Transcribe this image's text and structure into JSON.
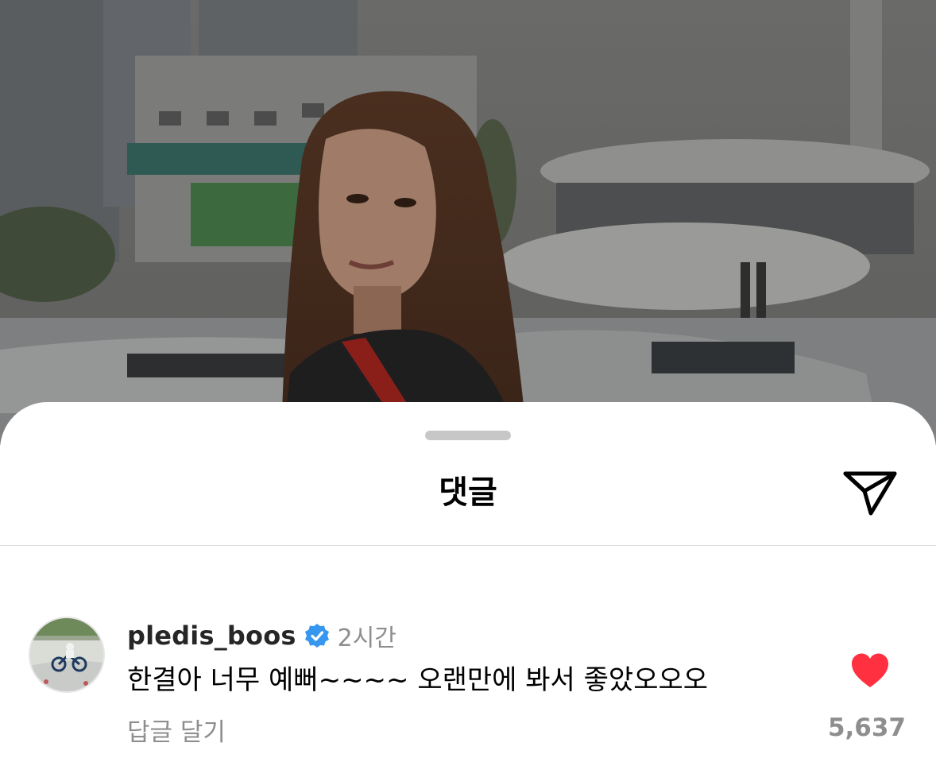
{
  "sheet": {
    "title": "댓글"
  },
  "icons": {
    "share": "paper-plane-icon",
    "verified": "verified-badge-icon",
    "like": "heart-icon"
  },
  "colors": {
    "like_red": "#ff3040",
    "verified_blue": "#3797f0",
    "secondary_text": "#8e8e8e"
  },
  "comment": {
    "username": "pledis_boos",
    "time": "2시간",
    "text": "한결아 너무 예뻐~~~~ 오랜만에 봐서 좋았오오오",
    "reply_label": "답글 달기",
    "like_count": "5,637",
    "liked": true
  }
}
